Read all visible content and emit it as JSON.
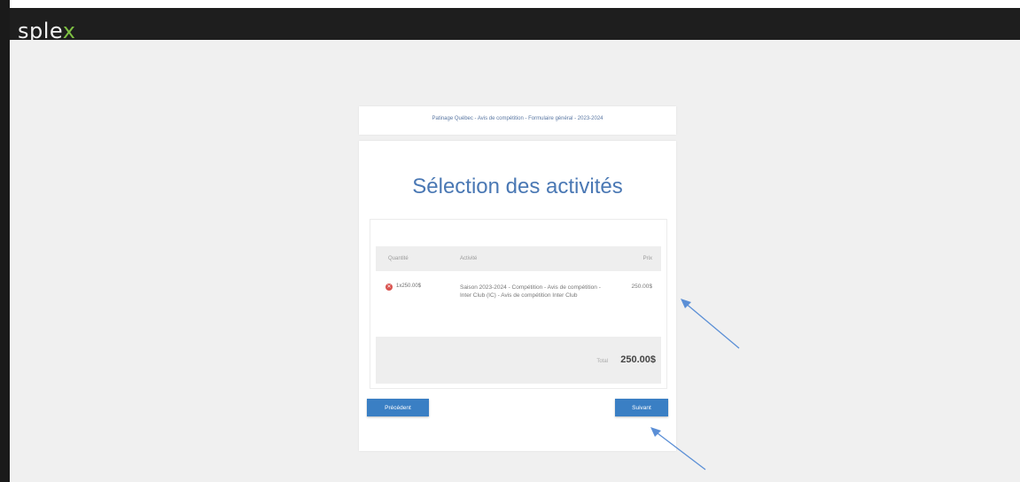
{
  "header": {
    "logo_main": "sple",
    "logo_accent": "x"
  },
  "breadcrumb": "Patinage Québec - Avis de compétition - Formulaire général - 2023-2024",
  "page_title": "Sélection des activités",
  "table": {
    "headers": {
      "quantity": "Quantité",
      "activity": "Activité",
      "price": "Prix"
    },
    "rows": [
      {
        "quantity": "1x250.00$",
        "activity": "Saison 2023-2024 - Compétition - Avis de compétition - Inter Club (IC) - Avis de compétition Inter Club",
        "price": "250.00$"
      }
    ],
    "total_label": "Total",
    "total_value": "250.00$"
  },
  "buttons": {
    "previous": "Précédent",
    "next": "Suivant"
  },
  "colors": {
    "accent": "#3a7fc4",
    "title": "#4a78b4",
    "logo_accent": "#7ec043",
    "remove": "#d9534f",
    "annotation_arrow": "#5b8fd6"
  },
  "icons": {
    "remove": "remove-circle-icon",
    "annotation": "arrow-annotation-icon"
  }
}
